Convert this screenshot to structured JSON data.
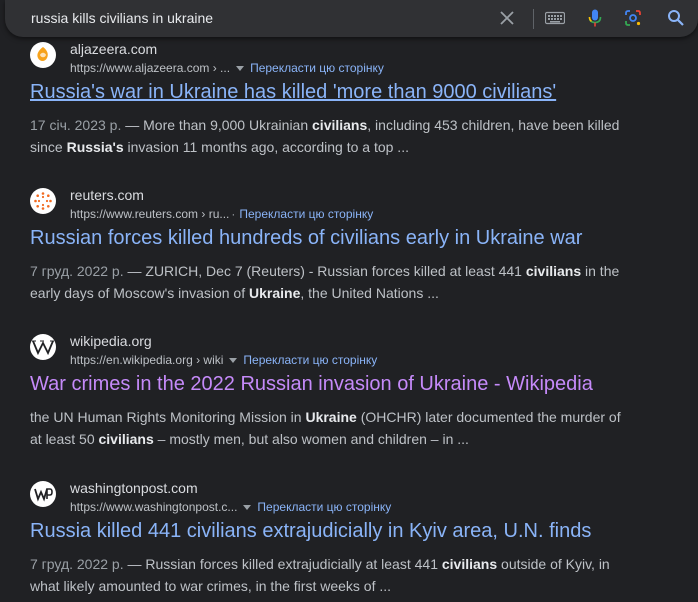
{
  "search": {
    "query": "russia kills civilians in ukraine"
  },
  "icons": {
    "clear": "close-icon",
    "keyboard": "keyboard-icon",
    "voice": "microphone-icon",
    "lens": "camera-lens-icon",
    "search": "search-icon"
  },
  "colors": {
    "background": "#202124",
    "link": "#8ab4f8",
    "visited": "#c58af9",
    "snippet": "#bdc1c6"
  },
  "results": [
    {
      "site": "aljazeera.com",
      "url": "https://www.aljazeera.com › ...",
      "translate": "Перекласти цю сторінку",
      "title": "Russia's war in Ukraine has killed 'more than 9000 civilians'",
      "date": "17 січ. 2023 р.",
      "snippet_parts": [
        " — More than 9,000 Ukrainian ",
        "civilians",
        ", including 453 children, have been killed since ",
        "Russia's",
        " invasion 11 months ago, according to a top ..."
      ]
    },
    {
      "site": "reuters.com",
      "url": "https://www.reuters.com › ru...",
      "translate": "Перекласти цю сторінку",
      "title": "Russian forces killed hundreds of civilians early in Ukraine war",
      "date": "7 груд. 2022 р.",
      "snippet_parts": [
        " — ZURICH, Dec 7 (Reuters) - Russian forces killed at least 441 ",
        "civilians",
        " in the early days of Moscow's invasion of ",
        "Ukraine",
        ", the United Nations ..."
      ]
    },
    {
      "site": "wikipedia.org",
      "url": "https://en.wikipedia.org › wiki",
      "translate": "Перекласти цю сторінку",
      "title": "War crimes in the 2022 Russian invasion of Ukraine - Wikipedia",
      "snippet_parts": [
        "the UN Human Rights Monitoring Mission in ",
        "Ukraine",
        " (OHCHR) later documented the murder of at least 50 ",
        "civilians",
        " – mostly men, but also women and children – in ..."
      ]
    },
    {
      "site": "washingtonpost.com",
      "url": "https://www.washingtonpost.c...",
      "translate": "Перекласти цю сторінку",
      "title": "Russia killed 441 civilians extrajudicially in Kyiv area, U.N. finds",
      "date": "7 груд. 2022 р.",
      "snippet_parts": [
        " — Russian forces killed extrajudicially at least 441 ",
        "civilians",
        " outside of Kyiv, in what likely amounted to war crimes, in the first weeks of ..."
      ]
    }
  ]
}
